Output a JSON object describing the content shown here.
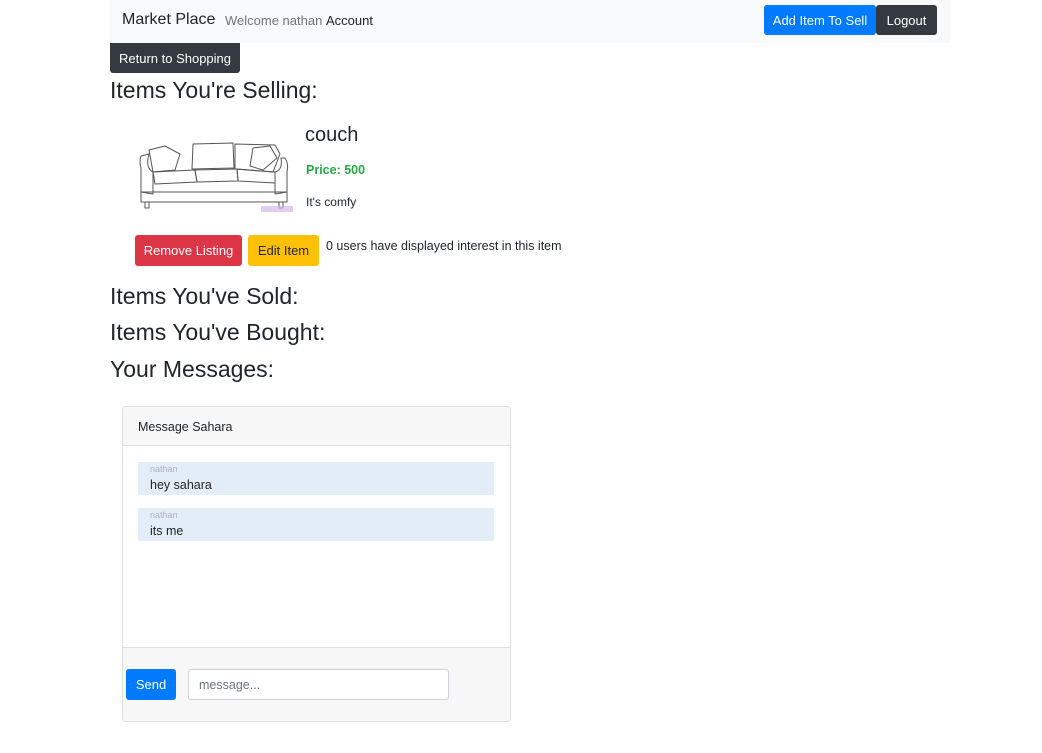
{
  "navbar": {
    "brand": "Market Place",
    "welcome": "Welcome nathan",
    "account": "Account",
    "add_item_label": "Add Item To Sell",
    "logout_label": "Logout"
  },
  "return_label": "Return to Shopping",
  "sections": {
    "selling": "Items You're Selling:",
    "sold": "Items You've Sold:",
    "bought": "Items You've Bought:",
    "messages": "Your Messages:"
  },
  "selling_items": [
    {
      "title": "couch",
      "price": "Price: 500",
      "description": "It's comfy",
      "image": "couch-sketch",
      "remove_label": "Remove Listing",
      "edit_label": "Edit Item",
      "interest_text": "0 users have displayed interest in this item"
    }
  ],
  "chat": {
    "header": "Message Sahara",
    "messages": [
      {
        "author": "nathan",
        "text": "hey sahara"
      },
      {
        "author": "nathan",
        "text": "its me"
      }
    ],
    "send_label": "Send",
    "input_placeholder": "message...",
    "input_value": ""
  },
  "colors": {
    "primary": "#007bff",
    "dark": "#343a40",
    "danger": "#dc3545",
    "warning": "#ffc107",
    "success": "#28a745",
    "message_bg": "#e3edf7"
  }
}
